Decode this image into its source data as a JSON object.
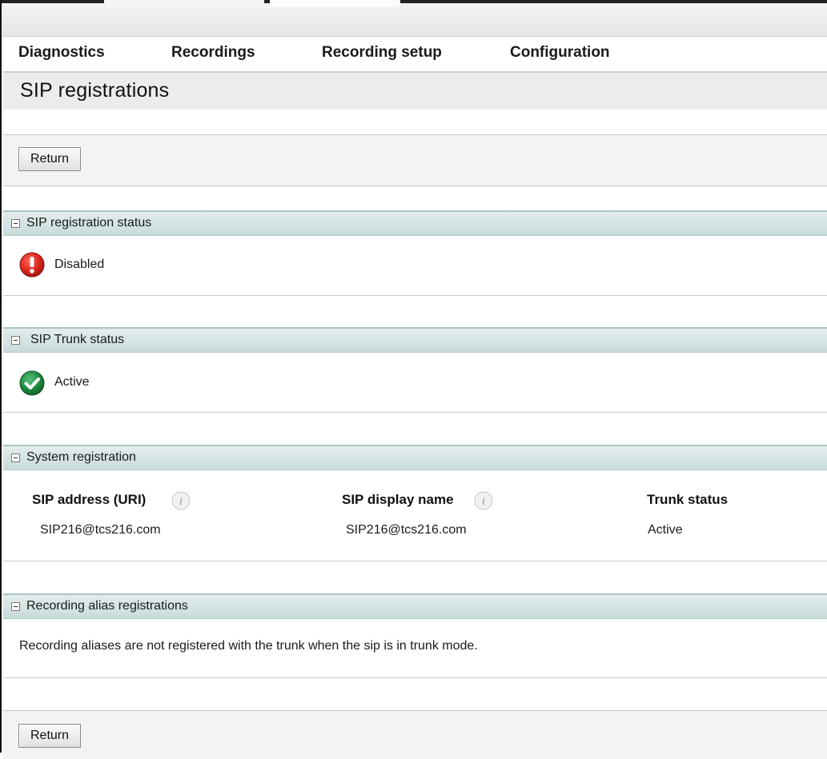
{
  "nav": {
    "items": [
      "Diagnostics",
      "Recordings",
      "Recording setup",
      "Configuration"
    ]
  },
  "page": {
    "title": "SIP registrations"
  },
  "buttons": {
    "return_top": "Return",
    "return_bottom": "Return"
  },
  "sections": {
    "sip_registration_status": {
      "title": "SIP registration status",
      "status": "Disabled",
      "icon": "error-icon",
      "color": "#d9261c"
    },
    "sip_trunk_status": {
      "title": "SIP Trunk status",
      "status": "Active",
      "icon": "check-icon",
      "color": "#1f8a3f"
    },
    "system_registration": {
      "title": "System registration",
      "columns": [
        "SIP address (URI)",
        "SIP display name",
        "Trunk status"
      ],
      "row": [
        "SIP216@tcs216.com",
        "SIP216@tcs216.com",
        "Active"
      ]
    },
    "recording_alias_registrations": {
      "title": "Recording alias registrations",
      "message": "Recording aliases are not registered with the trunk when the sip is in trunk mode."
    }
  }
}
